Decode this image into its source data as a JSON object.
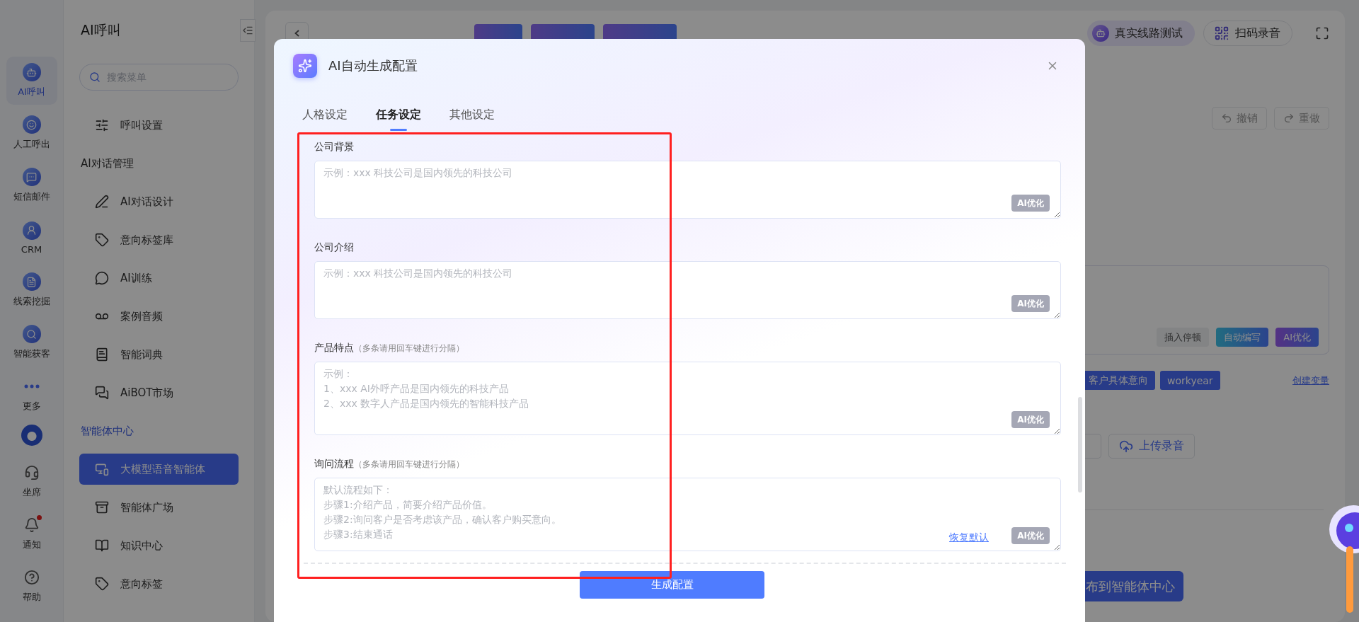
{
  "rail": {
    "items": [
      {
        "label": "AI呼叫",
        "selected": true,
        "dot": false
      },
      {
        "label": "人工呼出",
        "selected": false,
        "dot": false
      },
      {
        "label": "短信邮件",
        "selected": false,
        "dot": false
      },
      {
        "label": "CRM",
        "selected": false,
        "dot": false
      },
      {
        "label": "线索挖掘",
        "selected": false,
        "dot": false
      },
      {
        "label": "智能获客",
        "selected": false,
        "dot": false
      },
      {
        "label": "更多",
        "selected": false,
        "dot": false
      },
      {
        "label": "坐席",
        "selected": false,
        "dot": false
      },
      {
        "label": "通知",
        "selected": false,
        "dot": true
      },
      {
        "label": "帮助",
        "selected": false,
        "dot": false
      }
    ]
  },
  "sidebar": {
    "title": "AI呼叫",
    "search_placeholder": "搜索菜单",
    "sections": [
      {
        "items": [
          {
            "label": "呼叫设置",
            "selected": false
          }
        ]
      },
      {
        "heading": "AI对话管理",
        "active": false,
        "items": [
          {
            "label": "AI对话设计",
            "selected": false
          },
          {
            "label": "意向标签库",
            "selected": false
          },
          {
            "label": "AI训练",
            "selected": false
          },
          {
            "label": "案例音频",
            "selected": false
          },
          {
            "label": "智能词典",
            "selected": false
          },
          {
            "label": "AiBOT市场",
            "selected": false
          }
        ]
      },
      {
        "heading": "智能体中心",
        "active": true,
        "items": [
          {
            "label": "大模型语音智能体",
            "selected": true
          },
          {
            "label": "智能体广场",
            "selected": false
          },
          {
            "label": "知识中心",
            "selected": false
          },
          {
            "label": "意向标签",
            "selected": false
          }
        ]
      }
    ]
  },
  "page": {
    "actions": [
      {
        "label": "真实线路测试",
        "kind": "test"
      },
      {
        "label": "扫码录音",
        "kind": "scan"
      }
    ],
    "history": [
      "撤销",
      "重做"
    ],
    "editor_buttons": [
      {
        "label": "插入停顿",
        "kind": "plain"
      },
      {
        "label": "自动编写",
        "kind": "write"
      },
      {
        "label": "AI优化",
        "kind": "ai"
      }
    ],
    "variables": [
      "客户具体意向",
      "workyear"
    ],
    "create_variable": "创建变量",
    "upload": "上传录音",
    "publish": "布到智能体中心"
  },
  "modal": {
    "title": "AI自动生成配置",
    "tabs": [
      {
        "label": "人格设定",
        "selected": false
      },
      {
        "label": "任务设定",
        "selected": true
      },
      {
        "label": "其他设定",
        "selected": false
      }
    ],
    "fields": [
      {
        "label": "公司背景",
        "placeholder": [
          "示例：xxx 科技公司是国内领先的科技公司"
        ],
        "action": "AI优化"
      },
      {
        "label": "公司介绍",
        "placeholder": [
          "示例：xxx 科技公司是国内领先的科技公司"
        ],
        "action": "AI优化"
      },
      {
        "label": "产品特点",
        "hint": "（多条请用回车键进行分隔）",
        "placeholder": [
          "示例：",
          "1、xxx AI外呼产品是国内领先的科技产品",
          "2、xxx 数字人产品是国内领先的智能科技产品"
        ],
        "action": "AI优化"
      },
      {
        "label": "询问流程",
        "hint": "（多条请用回车键进行分隔）",
        "placeholder": [
          "默认流程如下：",
          "步骤1:介绍产品，简要介绍产品价值。",
          "步骤2:询问客户是否考虑该产品，确认客户购买意向。",
          "步骤3:结束通话"
        ],
        "restore": "恢复默认",
        "action": "AI优化"
      }
    ],
    "submit": "生成配置"
  }
}
